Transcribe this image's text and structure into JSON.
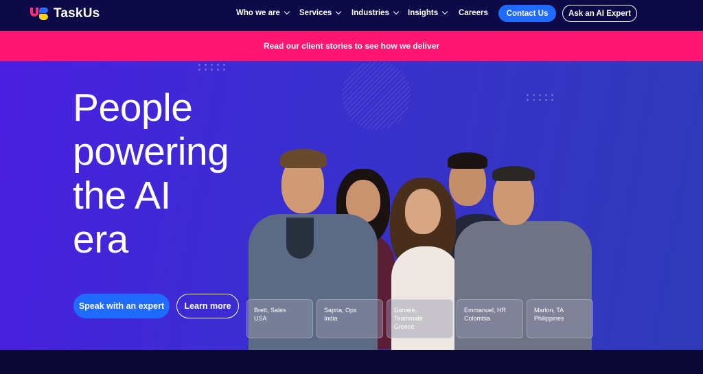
{
  "brand": {
    "name": "TaskUs"
  },
  "nav": {
    "items": [
      {
        "label": "Who we are",
        "dropdown": true
      },
      {
        "label": "Services",
        "dropdown": true
      },
      {
        "label": "Industries",
        "dropdown": true
      },
      {
        "label": "Insights",
        "dropdown": true
      },
      {
        "label": "Careers",
        "dropdown": false
      }
    ],
    "contact_label": "Contact Us",
    "ai_expert_label": "Ask an AI Expert"
  },
  "banner": {
    "text": "Read our client stories to see how we deliver"
  },
  "hero": {
    "title_lines": [
      "People",
      "powering",
      "the AI",
      "era"
    ],
    "primary_cta": "Speak with an expert",
    "secondary_cta": "Learn more"
  },
  "people": [
    {
      "line1": "Brett, Sales",
      "line2": "USA"
    },
    {
      "line1": "Sapna, Ops",
      "line2": "India"
    },
    {
      "line1": "Daniele,",
      "line2": "Teammate",
      "line3": "Greece"
    },
    {
      "line1": "Emmanuel, HR",
      "line2": "Colombia"
    },
    {
      "line1": "Marlon, TA",
      "line2": "Philippines"
    }
  ],
  "colors": {
    "nav_bg": "#0c0a47",
    "banner_bg": "#ff1670",
    "accent_blue": "#1f6bff",
    "hero_gradient_start": "#4a1fe0",
    "hero_gradient_end": "#2f3ab8"
  }
}
